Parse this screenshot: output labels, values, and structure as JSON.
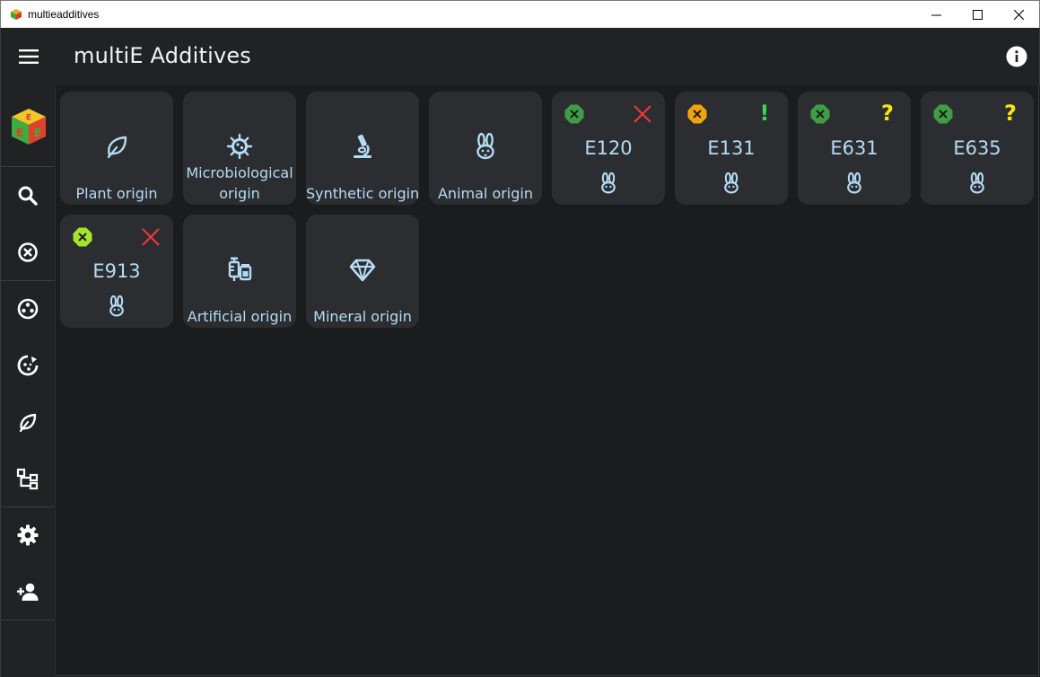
{
  "window": {
    "title": "multieadditives",
    "controls": [
      "minimize-icon",
      "maximize-icon",
      "close-icon"
    ]
  },
  "appbar": {
    "title": "multiE Additives",
    "menu_icon": "hamburger-menu-icon",
    "info_icon": "info-icon"
  },
  "sidebar": {
    "logo": "multie-cube-logo",
    "items": [
      {
        "icon": "search-icon"
      },
      {
        "icon": "circle-x-icon"
      },
      {
        "icon": "palette-icon"
      },
      {
        "icon": "recycle-cookie-icon"
      },
      {
        "icon": "leaf-icon"
      },
      {
        "icon": "sitemap-icon"
      },
      {
        "icon": "gear-icon"
      },
      {
        "icon": "add-user-icon"
      }
    ]
  },
  "colors": {
    "accent_text": "#b5dcf6",
    "tile_bg": "#2b2d30",
    "status_green": "#3f9e43",
    "status_orange": "#f0a30a",
    "status_lime": "#a6e22e",
    "mark_red": "#e8383d",
    "mark_green": "#3ad35c",
    "mark_yellow": "#f5e60c"
  },
  "tiles": [
    {
      "type": "category",
      "label": "Plant origin",
      "icon": "leaf-icon"
    },
    {
      "type": "category",
      "label_line1": "Microbiological",
      "label_line2": "origin",
      "icon": "virus-icon"
    },
    {
      "type": "category",
      "label": "Synthetic origin",
      "icon": "microscope-icon"
    },
    {
      "type": "category",
      "label": "Animal origin",
      "icon": "rabbit-icon"
    },
    {
      "type": "additive",
      "code": "E120",
      "status": "green",
      "mark": "✕",
      "mark_kind": "cross",
      "origin_icon": "rabbit-icon"
    },
    {
      "type": "additive",
      "code": "E131",
      "status": "orange",
      "mark": "!",
      "mark_kind": "exclamation",
      "origin_icon": "rabbit-icon"
    },
    {
      "type": "additive",
      "code": "E631",
      "status": "green",
      "mark": "?",
      "mark_kind": "question",
      "origin_icon": "rabbit-icon"
    },
    {
      "type": "additive",
      "code": "E635",
      "status": "green",
      "mark": "?",
      "mark_kind": "question",
      "origin_icon": "rabbit-icon"
    },
    {
      "type": "additive",
      "code": "E913",
      "status": "lime",
      "mark": "✕",
      "mark_kind": "cross",
      "origin_icon": "rabbit-icon"
    },
    {
      "type": "category",
      "label": "Artificial origin",
      "icon": "syringe-vials-icon"
    },
    {
      "type": "category",
      "label": "Mineral origin",
      "icon": "diamond-icon"
    }
  ]
}
